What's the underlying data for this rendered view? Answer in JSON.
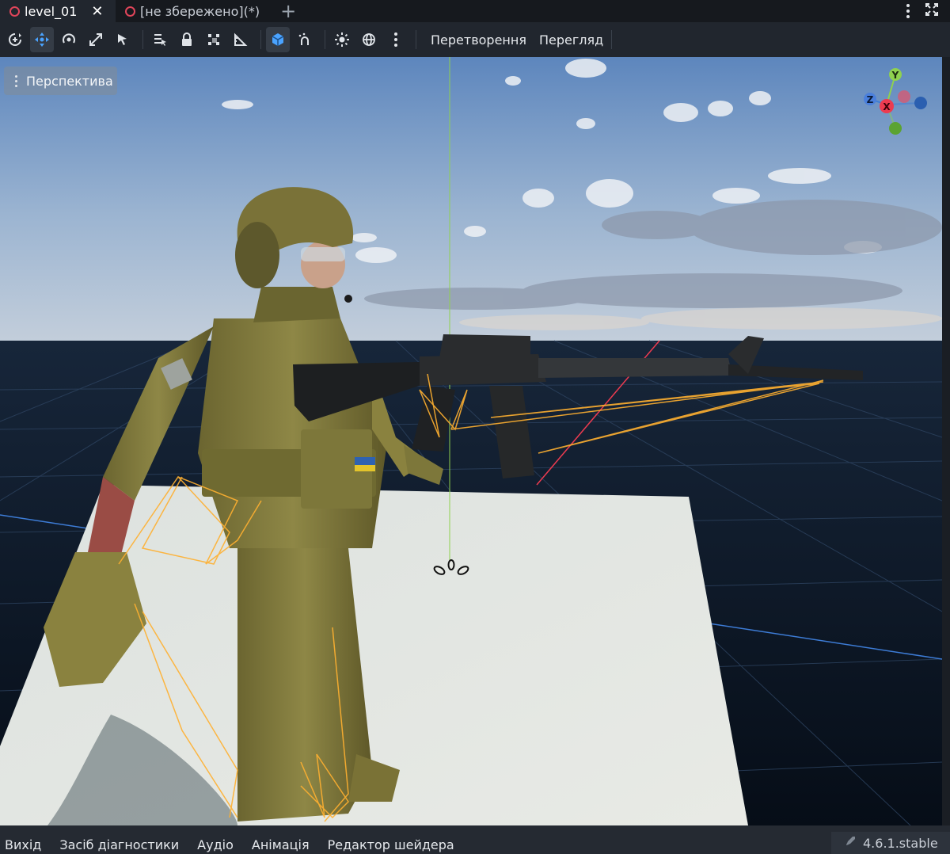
{
  "tabs": [
    {
      "label": "level_01",
      "active": true
    },
    {
      "label": "[не збережено](*)",
      "active": false
    }
  ],
  "tab_add_icon": "plus-icon",
  "toolbar": {
    "tools": [
      "transform-mode-icon",
      "move-mode-icon",
      "rotate-mode-icon",
      "scale-mode-icon",
      "select-mode-icon",
      "list-select-icon",
      "lock-icon",
      "snap-grid-icon",
      "ruler-icon",
      "local-space-icon",
      "snap-icon",
      "sun-icon",
      "environment-icon",
      "more-icon"
    ],
    "active_tool": "move-mode-icon",
    "menu_transform": "Перетворення",
    "menu_view": "Перегляд"
  },
  "viewport": {
    "perspective_label": "Перспектива",
    "gizmo": {
      "y": "Y",
      "x": "X",
      "z": "Z"
    },
    "colors": {
      "sky_top": "#5d86bd",
      "sky_horizon": "#c3cedb",
      "ground": "#0d1a2a",
      "floor_plane": "#dfe2df",
      "x_axis": "#ec3b50",
      "y_axis": "#8fd14f",
      "z_axis": "#3d7cd6",
      "bones": "#ffb030"
    }
  },
  "bottom": {
    "items": [
      "Вихід",
      "Засіб діагностики",
      "Аудіо",
      "Анімація",
      "Редактор шейдера"
    ],
    "version": "4.6.1.stable",
    "version_icon": "rocket-icon"
  }
}
